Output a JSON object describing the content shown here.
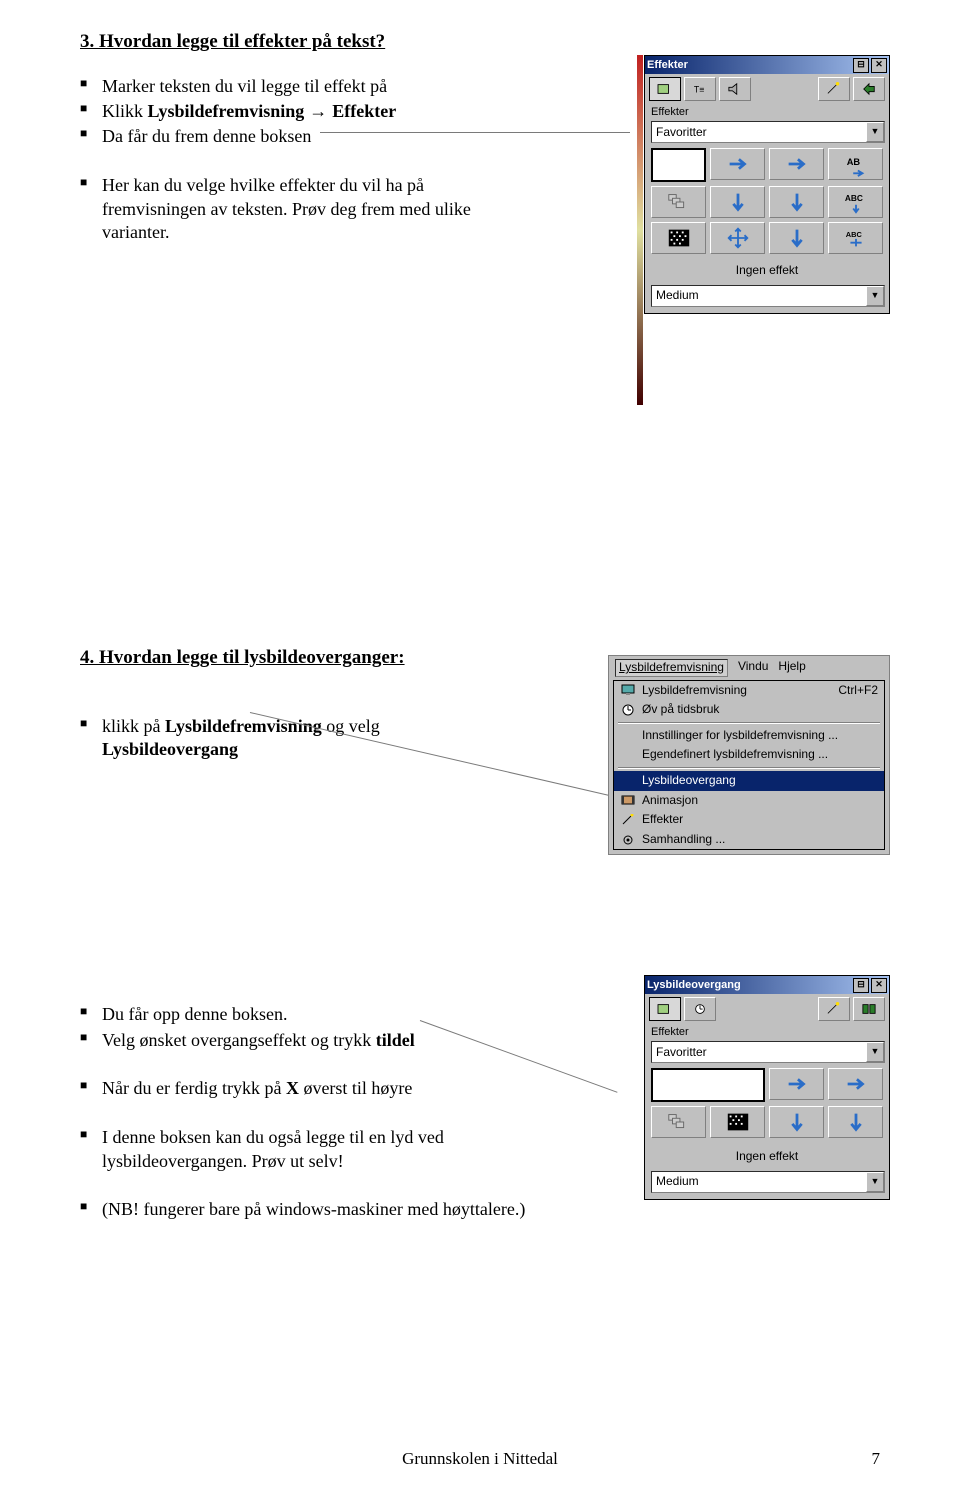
{
  "section3": {
    "heading": "3. Hvordan legge til effekter på tekst?",
    "items": [
      {
        "pre": "Marker teksten du vil legge til effekt på"
      },
      {
        "pre": "Klikk ",
        "b1": "Lysbildefremvisning",
        "arrow": " → ",
        "b2": "Effekter"
      },
      {
        "pre": "Da får du frem denne boksen"
      },
      {
        "pre": "Her kan du velge hvilke effekter du vil ha på fremvisningen av teksten. Prøv deg frem med ulike varianter."
      }
    ],
    "panel": {
      "title": "Effekter",
      "sectionLabel": "Effekter",
      "combo": "Favoritter",
      "noEffect": "Ingen effekt",
      "speedCombo": "Medium",
      "cellLabels": [
        "AB",
        "ABC",
        "ABC"
      ]
    }
  },
  "section4": {
    "heading": "4. Hvordan legge til lysbildeoverganger:",
    "item1": {
      "pre": "klikk på ",
      "b1": "Lysbildefremvisning",
      "mid": " og velg ",
      "b2": "Lysbildeovergang"
    },
    "menu": {
      "menubar": [
        "Lysbildefremvisning",
        "Vindu",
        "Hjelp"
      ],
      "items": [
        {
          "label": "Lysbildefremvisning",
          "shortcut": "Ctrl+F2",
          "icon": "screen"
        },
        {
          "label": "Øv på tidsbruk",
          "icon": "clock"
        },
        {
          "sep": true
        },
        {
          "label": "Innstillinger for lysbildefremvisning ..."
        },
        {
          "label": "Egendefinert lysbildefremvisning ..."
        },
        {
          "sep": true
        },
        {
          "label": "Lysbildeovergang",
          "highlight": true
        },
        {
          "label": "Animasjon",
          "icon": "film"
        },
        {
          "label": "Effekter",
          "icon": "wand"
        },
        {
          "label": "Samhandling ...",
          "icon": "gear"
        }
      ]
    },
    "lowerItems": [
      "Du får opp denne boksen.",
      "Velg ønsket overgangseffekt og trykk ",
      "Når du er ferdig trykk på ",
      "I denne boksen kan du også legge til en lyd ved lysbildeovergangen. Prøv ut selv!",
      "(NB! fungerer bare på windows-maskiner med høyttalere.)"
    ],
    "lowerBold": {
      "tildel": "tildel",
      "X": "X",
      "ovre": " øverst til høyre"
    },
    "panel": {
      "title": "Lysbildeovergang",
      "sectionLabel": "Effekter",
      "combo": "Favoritter",
      "noEffect": "Ingen effekt",
      "speedCombo": "Medium"
    }
  },
  "footer": {
    "center": "Grunnskolen i Nittedal",
    "page": "7"
  }
}
